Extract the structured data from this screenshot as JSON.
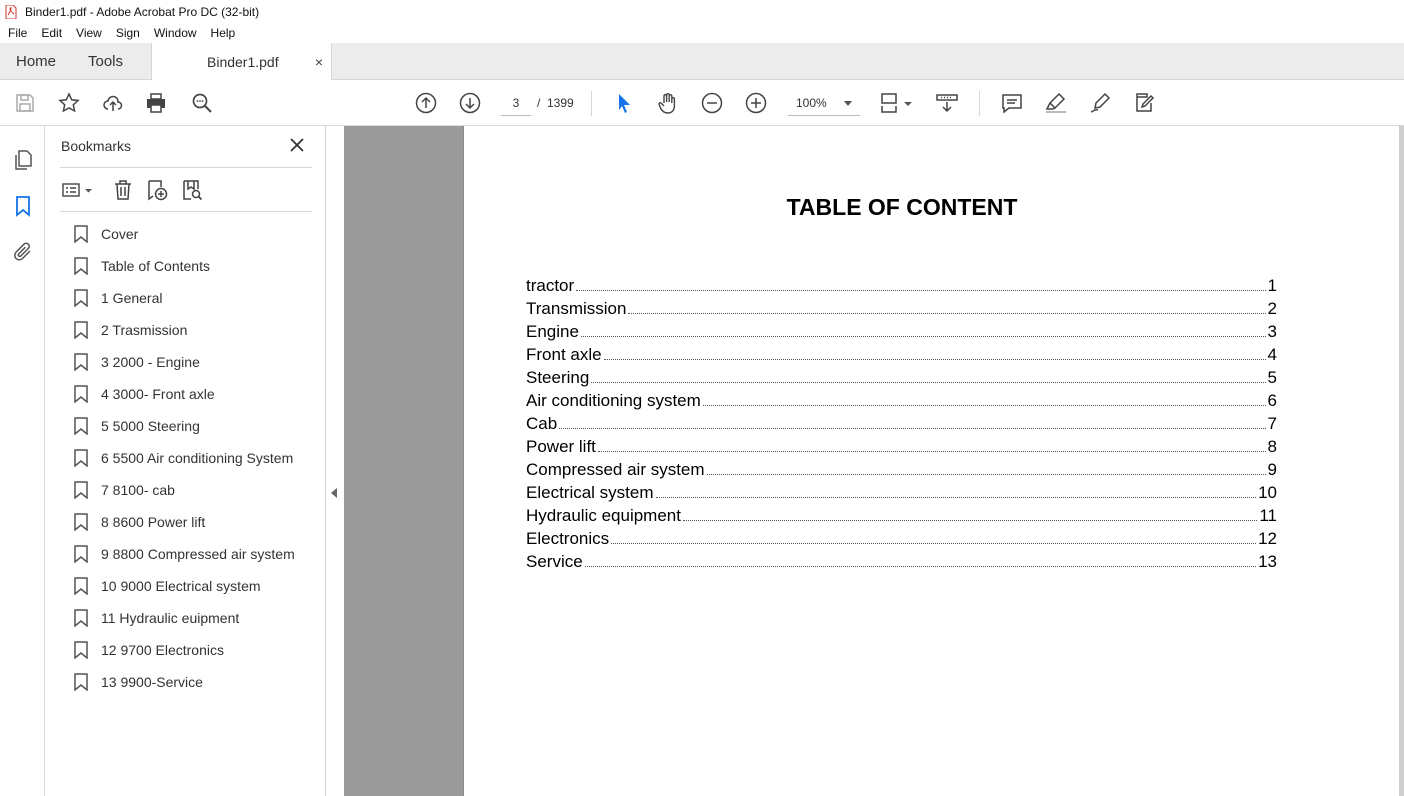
{
  "window": {
    "title": "Binder1.pdf - Adobe Acrobat Pro DC (32-bit)"
  },
  "menu": [
    "File",
    "Edit",
    "View",
    "Sign",
    "Window",
    "Help"
  ],
  "tabs": {
    "home": "Home",
    "tools": "Tools",
    "document": "Binder1.pdf",
    "close": "×"
  },
  "toolbar": {
    "current_page": "3",
    "page_separator": "/",
    "total_pages": "1399",
    "zoom": "100%"
  },
  "bookmarks": {
    "title": "Bookmarks",
    "items": [
      "Cover",
      "Table of Contents",
      "1 General",
      "2 Trasmission",
      "3 2000 - Engine",
      "4 3000- Front axle",
      "5 5000 Steering",
      "6 5500 Air conditioning System",
      "7 8100- cab",
      "8 8600 Power lift",
      "9 8800 Compressed air system",
      "10 9000 Electrical system",
      "11 Hydraulic euipment",
      "12 9700 Electronics",
      "13 9900-Service"
    ]
  },
  "document": {
    "heading": "TABLE OF CONTENT",
    "toc": [
      {
        "label": "tractor",
        "page": "1"
      },
      {
        "label": "Transmission",
        "page": "2"
      },
      {
        "label": "Engine",
        "page": "3"
      },
      {
        "label": "Front axle",
        "page": "4"
      },
      {
        "label": "Steering",
        "page": "5"
      },
      {
        "label": "Air conditioning system",
        "page": "6"
      },
      {
        "label": "Cab",
        "page": "7"
      },
      {
        "label": "Power lift",
        "page": "8"
      },
      {
        "label": "Compressed air system",
        "page": "9"
      },
      {
        "label": "Electrical system",
        "page": "10"
      },
      {
        "label": "Hydraulic equipment",
        "page": "11"
      },
      {
        "label": "Electronics",
        "page": "12"
      },
      {
        "label": "Service",
        "page": "13"
      }
    ]
  },
  "colors": {
    "accent": "#1473e6",
    "panel_border": "#d6d6d6",
    "viewer_bg": "#9b9b9b"
  }
}
